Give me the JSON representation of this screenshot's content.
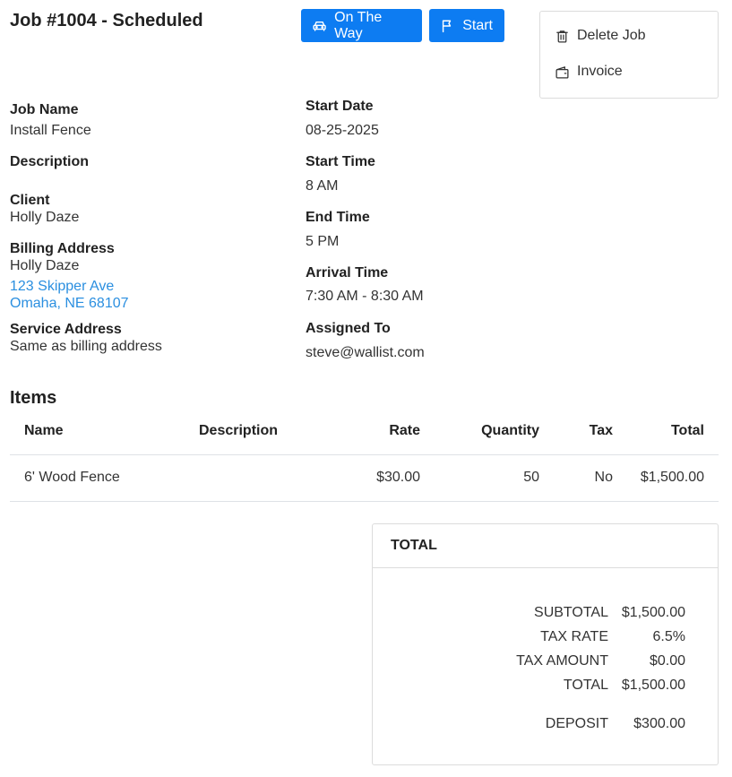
{
  "header": {
    "title": "Job #1004 - Scheduled",
    "on_the_way_label": "On The Way",
    "start_label": "Start"
  },
  "menu": {
    "delete_label": "Delete Job",
    "invoice_label": "Invoice"
  },
  "details": {
    "job_name_label": "Job Name",
    "job_name": "Install Fence",
    "description_label": "Description",
    "client_label": "Client",
    "client": "Holly Daze",
    "billing_label": "Billing Address",
    "billing_name": "Holly Daze",
    "billing_line1": "123 Skipper Ave",
    "billing_line2": "Omaha, NE 68107",
    "service_label": "Service Address",
    "service_value": "Same as billing address",
    "start_date_label": "Start Date",
    "start_date": "08-25-2025",
    "start_time_label": "Start Time",
    "start_time": "8 AM",
    "end_time_label": "End Time",
    "end_time": "5 PM",
    "arrival_label": "Arrival Time",
    "arrival": "7:30 AM - 8:30 AM",
    "assigned_label": "Assigned To",
    "assigned": "steve@wallist.com"
  },
  "items": {
    "heading": "Items",
    "columns": [
      "Name",
      "Description",
      "Rate",
      "Quantity",
      "Tax",
      "Total"
    ],
    "rows": [
      {
        "name": "6' Wood Fence",
        "description": "",
        "rate": "$30.00",
        "quantity": "50",
        "tax": "No",
        "total": "$1,500.00"
      }
    ]
  },
  "totals": {
    "title": "TOTAL",
    "subtotal_label": "SUBTOTAL",
    "subtotal": "$1,500.00",
    "tax_rate_label": "TAX RATE",
    "tax_rate": "6.5%",
    "tax_amount_label": "TAX AMOUNT",
    "tax_amount": "$0.00",
    "total_label": "TOTAL",
    "total": "$1,500.00",
    "deposit_label": "DEPOSIT",
    "deposit": "$300.00"
  },
  "colors": {
    "primary": "#0d7cf2",
    "link": "#2b8fe0"
  }
}
